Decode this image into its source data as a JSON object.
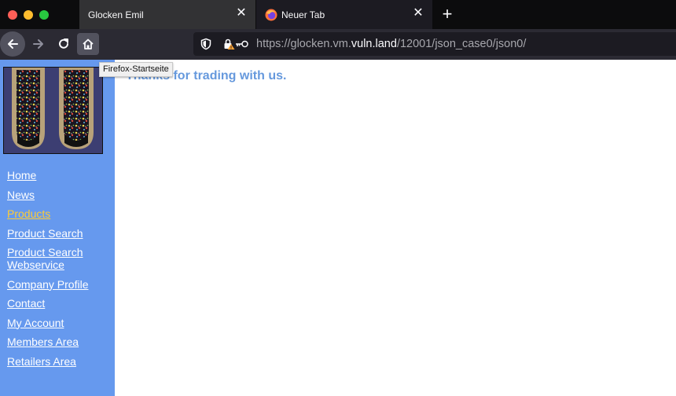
{
  "browser": {
    "tabs": [
      {
        "label": "Glocken Emil",
        "active": true
      },
      {
        "label": "Neuer Tab",
        "active": false
      }
    ],
    "url": {
      "prefix": "https://glocken.vm.",
      "host": "vuln.land",
      "path": "/12001/json_case0/json0/"
    },
    "tooltip": "Firefox-Startseite"
  },
  "sidebar": {
    "menu": [
      {
        "label": "Home",
        "current": false
      },
      {
        "label": "News",
        "current": false
      },
      {
        "label": "Products",
        "current": true
      },
      {
        "label": "Product Search",
        "current": false
      },
      {
        "label": "Product Search Webservice",
        "current": false
      },
      {
        "label": "Company Profile",
        "current": false
      },
      {
        "label": "Contact",
        "current": false
      },
      {
        "label": "My Account",
        "current": false
      },
      {
        "label": "Members Area",
        "current": false
      },
      {
        "label": "Retailers Area",
        "current": false
      }
    ]
  },
  "main": {
    "headline": "Thanks for trading with us."
  },
  "colors": {
    "sidebar_bg": "#6699ee",
    "menu_link": "#ffffff",
    "menu_current": "#ffcc33",
    "headline": "#6699dd"
  }
}
